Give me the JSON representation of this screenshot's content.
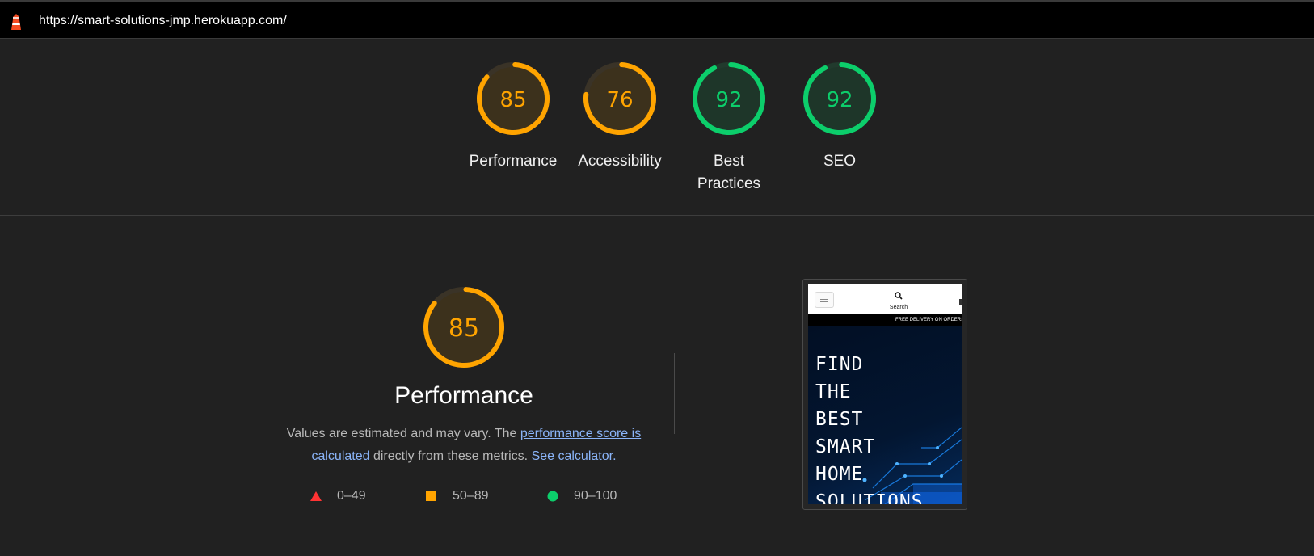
{
  "urlbar": {
    "url": "https://smart-solutions-jmp.herokuapp.com/"
  },
  "categories": [
    {
      "score": "85",
      "label_line1": "Performance",
      "label_line2": "",
      "color": "#ffa400",
      "fraction": 0.85
    },
    {
      "score": "76",
      "label_line1": "Accessibility",
      "label_line2": "",
      "color": "#ffa400",
      "fraction": 0.76
    },
    {
      "score": "92",
      "label_line1": "Best",
      "label_line2": "Practices",
      "color": "#0cce6b",
      "fraction": 0.92
    },
    {
      "score": "92",
      "label_line1": "SEO",
      "label_line2": "",
      "color": "#0cce6b",
      "fraction": 0.92
    }
  ],
  "performance": {
    "score": "85",
    "fraction": 0.85,
    "title": "Performance",
    "desc_prefix": "Values are estimated and may vary. The ",
    "link_score": "performance score is calculated",
    "desc_middle": " directly from these metrics. ",
    "link_calc": "See calculator."
  },
  "legend": {
    "fail": "0–49",
    "average": "50–89",
    "pass": "90–100",
    "fail_color": "#ff3333",
    "average_color": "#ffa400",
    "pass_color": "#0cce6b"
  },
  "screenshot": {
    "search_label": "Search",
    "banner": "FREE DELIVERY ON ORDERS O",
    "hero_lines": [
      "FIND",
      "THE",
      "BEST",
      "SMART",
      "HOME",
      "SOLUTIONS"
    ]
  }
}
